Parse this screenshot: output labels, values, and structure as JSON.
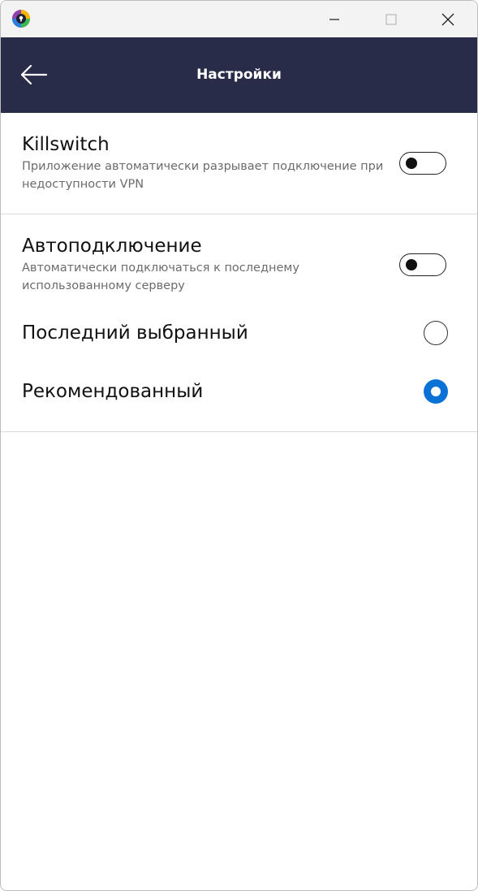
{
  "window": {
    "controls": {
      "minimize_icon": "minimize-icon",
      "maximize_icon": "maximize-icon",
      "close_icon": "close-icon"
    },
    "app_icon": "app-logo-icon"
  },
  "header": {
    "title": "Настройки",
    "back_icon": "arrow-left-icon",
    "background": "#292c48"
  },
  "settings": {
    "killswitch": {
      "title": "Killswitch",
      "description": "Приложение автоматически разрывает подключение при недоступности VPN",
      "enabled": false
    },
    "autoconnect": {
      "title": "Автоподключение",
      "description": "Автоматически подключаться к последнему использованному серверу",
      "enabled": false,
      "options": [
        {
          "label": "Последний выбранный",
          "selected": false
        },
        {
          "label": "Рекомендованный",
          "selected": true
        }
      ]
    }
  },
  "colors": {
    "accent": "#0a72d4",
    "header_bg": "#292c48",
    "divider": "#dcdcdc",
    "secondary_text": "#6b6b6b"
  }
}
